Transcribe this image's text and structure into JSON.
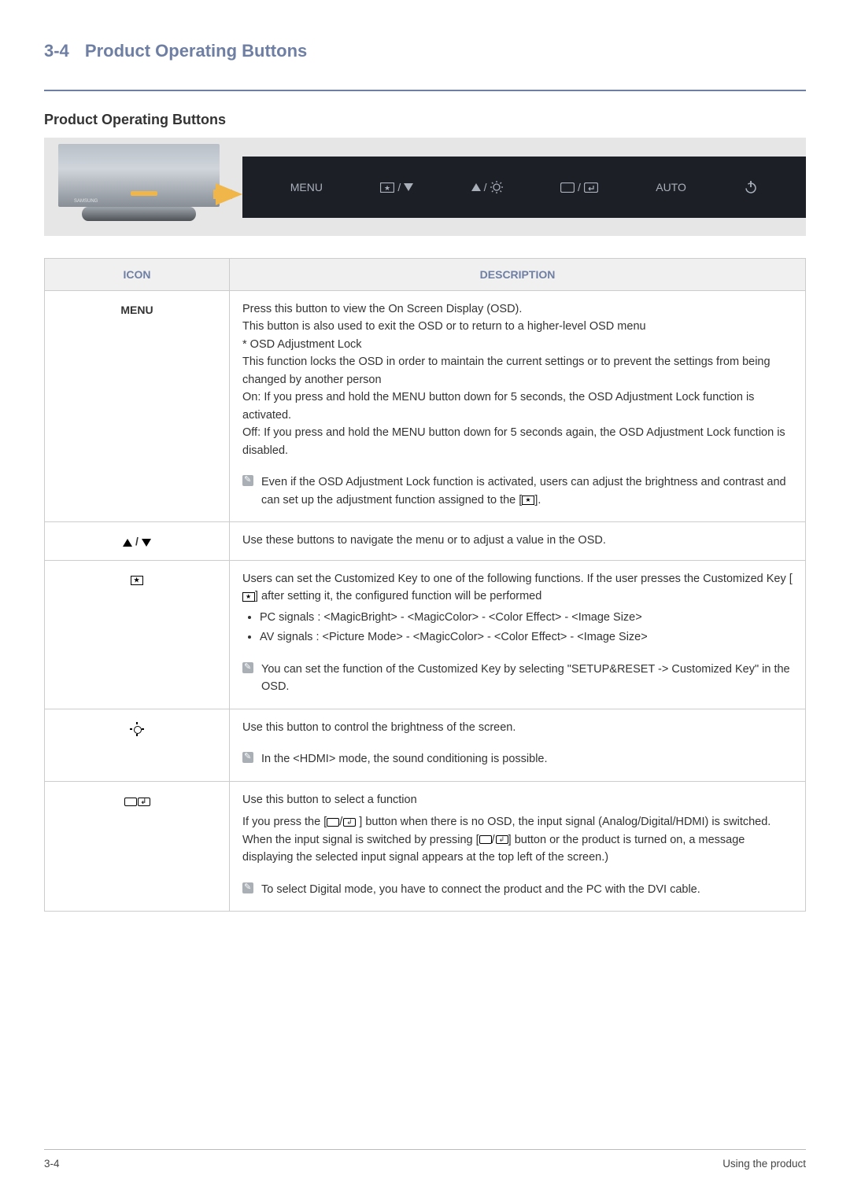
{
  "section": {
    "number": "3-4",
    "title": "Product Operating Buttons"
  },
  "sub_title": "Product Operating Buttons",
  "strip_labels": {
    "menu": "MENU",
    "custom_down": "▼",
    "up_bright": "",
    "source": "",
    "auto": "AUTO"
  },
  "table": {
    "header_icon": "ICON",
    "header_desc": "DESCRIPTION",
    "rows": {
      "menu": {
        "icon_label": "MENU",
        "p1": "Press this button to view the On Screen Display (OSD).",
        "p2": "This button is also used to exit the OSD or to return to a higher-level OSD menu",
        "p3": "* OSD Adjustment Lock",
        "p4": "This function locks the OSD in order to maintain the current settings or to prevent the settings from being changed by another person",
        "p5": "On: If you press and hold the MENU button down for 5 seconds, the OSD Adjustment Lock function is activated.",
        "p6": "Off: If you press and hold the MENU button down for 5 seconds again, the OSD Adjustment Lock function is disabled.",
        "note_a": "Even if the OSD Adjustment Lock function is activated, users can adjust the brightness and contrast and can set up the adjustment function assigned to the [",
        "note_b": "]."
      },
      "updown": {
        "desc": "Use these buttons to navigate the menu or to adjust a value in the OSD."
      },
      "custom": {
        "p1a": "Users can set the Customized Key to one of the following functions. If the user presses the Customized Key [",
        "p1b": "] after setting it, the configured function will be performed",
        "b1": "PC signals : <MagicBright> - <MagicColor> - <Color Effect> - <Image Size>",
        "b2": "AV signals : <Picture Mode> - <MagicColor> - <Color Effect> - <Image Size>",
        "note": "You can set the function of the Customized Key by selecting \"SETUP&RESET -> Customized Key\" in the OSD."
      },
      "bright": {
        "p1": "Use this button to control the brightness of the screen.",
        "note": "In the <HDMI> mode, the sound conditioning is possible."
      },
      "source": {
        "p1": "Use this button to select a function",
        "p2a": "If you press the [",
        "p2b": " ] button when there is no OSD, the input signal (Analog/Digital/HDMI) is switched. When the input signal is switched by pressing [",
        "p2c": "] button or the product is turned on, a message displaying the selected input signal appears at the top left of the screen.)",
        "note": "To select Digital mode, you have to connect the product and the PC with the DVI cable."
      }
    }
  },
  "footer": {
    "left": "3-4",
    "right": "Using the product"
  }
}
